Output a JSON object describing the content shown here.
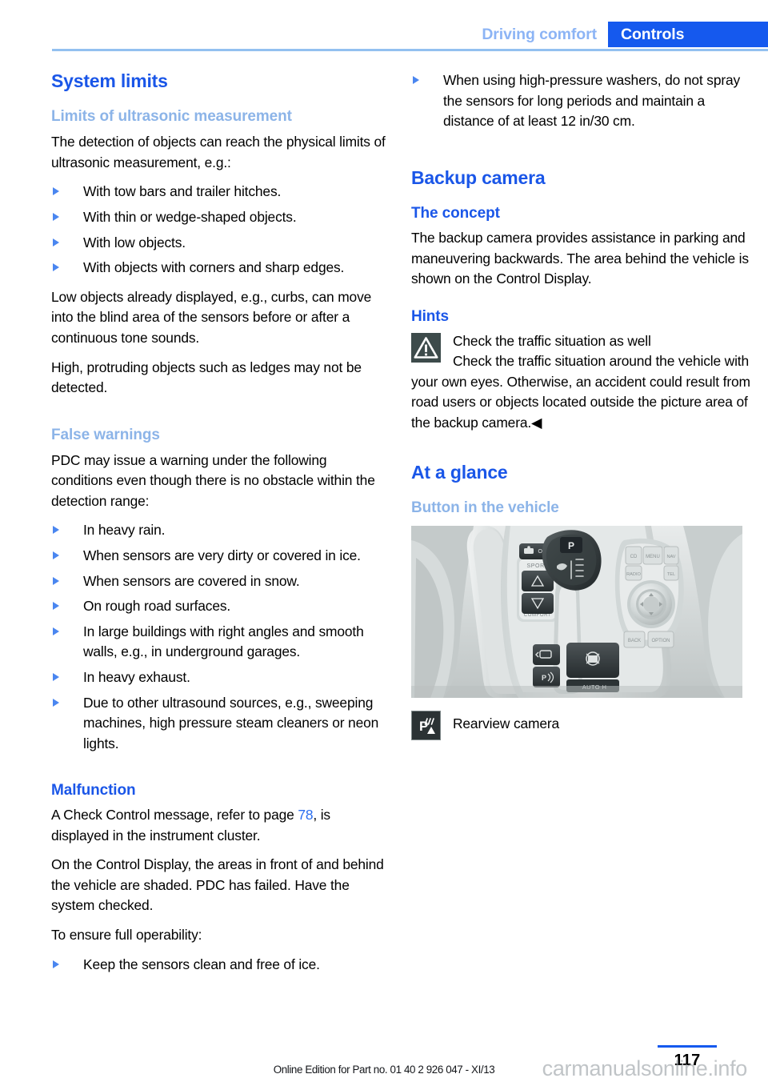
{
  "header": {
    "inactive_tab": "Driving comfort",
    "active_tab": "Controls",
    "accent_blue": "#1559ee",
    "light_blue": "#8cb4f5"
  },
  "left_column": {
    "section_title": "System limits",
    "block_ultrasonic": {
      "heading": "Limits of ultrasonic measurement",
      "intro": "The detection of objects can reach the physical limits of ultrasonic measurement, e.g.:",
      "bullets": [
        "With tow bars and trailer hitches.",
        "With thin or wedge-shaped objects.",
        "With low objects.",
        "With objects with corners and sharp edges."
      ],
      "para_1": "Low objects already displayed, e.g., curbs, can move into the blind area of the sensors before or after a continuous tone sounds.",
      "para_2": "High, protruding objects such as ledges may not be detected."
    },
    "block_false_warnings": {
      "heading": "False warnings",
      "intro": "PDC may issue a warning under the following conditions even though there is no obstacle within the detection range:",
      "bullets": [
        "In heavy rain.",
        "When sensors are very dirty or covered in ice.",
        "When sensors are covered in snow.",
        "On rough road surfaces.",
        "In large buildings with right angles and smooth walls, e.g., in underground garages.",
        "In heavy exhaust.",
        "Due to other ultrasound sources, e.g., sweeping machines, high pressure steam cleaners or neon lights."
      ]
    },
    "block_malfunction": {
      "heading": "Malfunction",
      "para_1_before": "A Check Control message, refer to page ",
      "para_1_link": "78",
      "para_1_after": ", is displayed in the instrument cluster.",
      "para_2": "On the Control Display, the areas in front of and behind the vehicle are shaded. PDC has failed. Have the system checked.",
      "para_3": "To ensure full operability:",
      "bullets": [
        "Keep the sensors clean and free of ice."
      ]
    }
  },
  "right_column": {
    "top_bullets": [
      "When using high-pressure washers, do not spray the sensors for long periods and maintain a distance of at least 12 in/30 cm."
    ],
    "section_title": "Backup camera",
    "block_concept": {
      "heading": "The concept",
      "para_1": "The backup camera provides assistance in parking and maneuvering backwards. The area behind the vehicle is shown on the Control Display."
    },
    "block_hints": {
      "heading": "Hints",
      "warning_title": "Check the traffic situation as well",
      "warning_body": "Check the traffic situation around the vehicle with your own eyes. Otherwise, an accident could result from road users or objects located outside the picture area of the backup camera.◀"
    },
    "block_at_a_glance": {
      "section_title": "At a glance",
      "heading": "Button in the vehicle",
      "photo_alt": "vehicle-center-console-photo",
      "caption": "Rearview camera"
    }
  },
  "footer": {
    "page_number": "117",
    "edition": "Online Edition for Part no. 01 40 2 926 047 - XI/13",
    "watermark": "carmanualsonline.info"
  }
}
